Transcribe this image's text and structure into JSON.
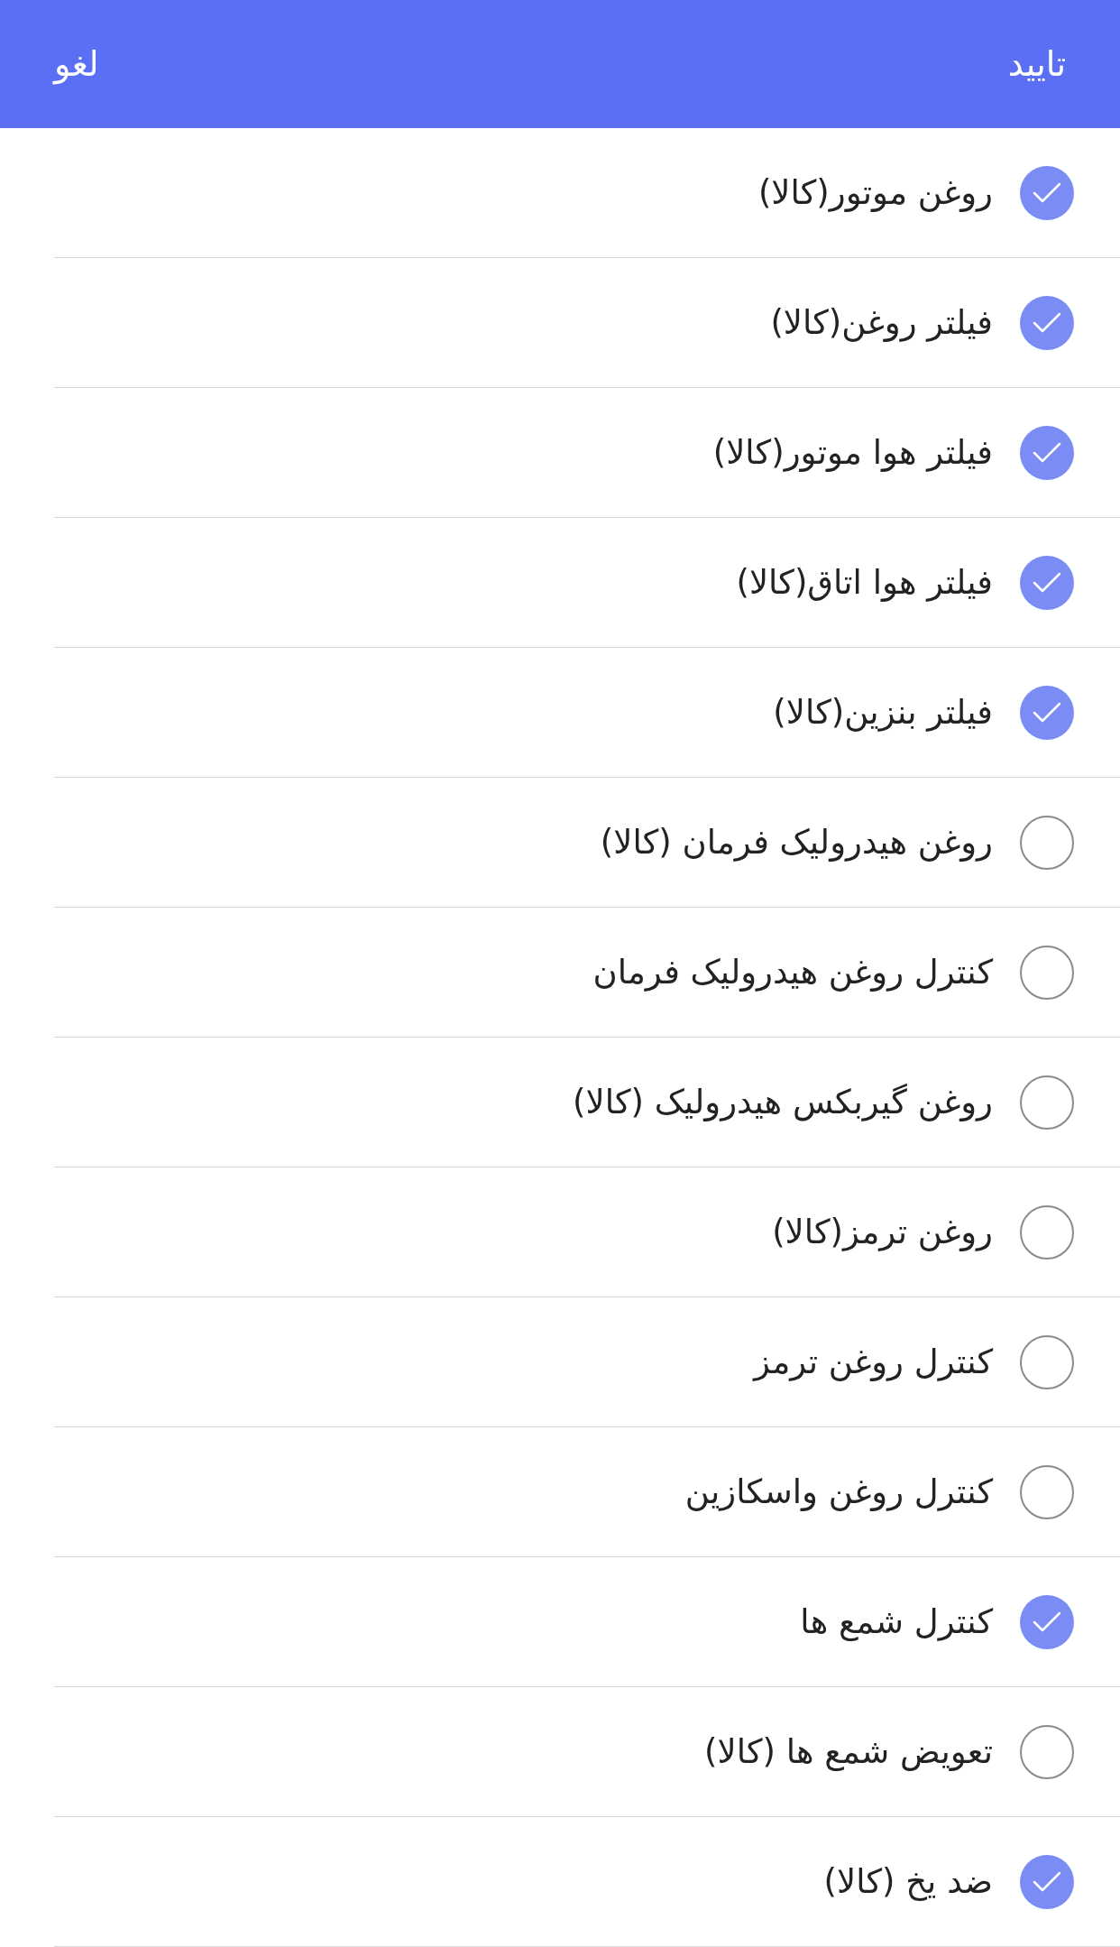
{
  "header": {
    "confirm": "تایید",
    "cancel": "لغو"
  },
  "items": [
    {
      "label": "روغن موتور(کالا)",
      "checked": true
    },
    {
      "label": "فیلتر روغن(کالا)",
      "checked": true
    },
    {
      "label": "فیلتر هوا موتور(کالا)",
      "checked": true
    },
    {
      "label": "فیلتر هوا اتاق(کالا)",
      "checked": true
    },
    {
      "label": "فیلتر بنزین(کالا)",
      "checked": true
    },
    {
      "label": "روغن هیدرولیک فرمان (کالا)",
      "checked": false
    },
    {
      "label": "کنترل روغن هیدرولیک فرمان",
      "checked": false
    },
    {
      "label": "روغن گیربکس هیدرولیک (کالا)",
      "checked": false
    },
    {
      "label": "روغن ترمز(کالا)",
      "checked": false
    },
    {
      "label": "کنترل روغن ترمز",
      "checked": false
    },
    {
      "label": "کنترل روغن واسکازین",
      "checked": false
    },
    {
      "label": "کنترل شمع ها",
      "checked": true
    },
    {
      "label": "تعویض شمع ها (کالا)",
      "checked": false
    },
    {
      "label": "ضد یخ (کالا)",
      "checked": true
    }
  ]
}
